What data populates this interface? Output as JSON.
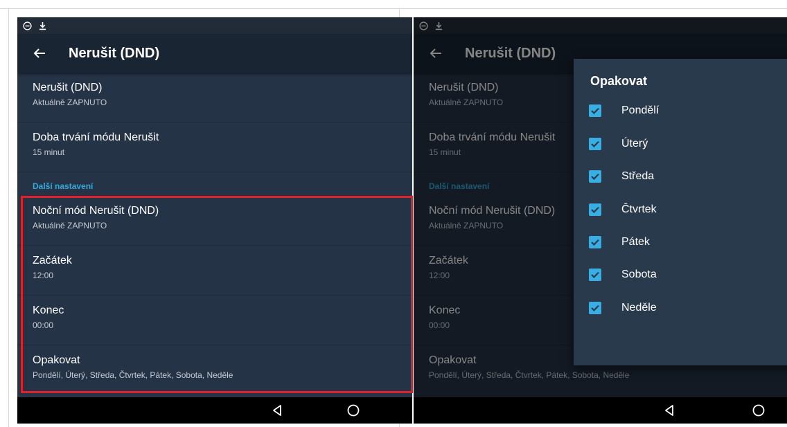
{
  "app": {
    "title": "Nerušit (DND)"
  },
  "settings": [
    {
      "title": "Nerušit (DND)",
      "sub": "Aktuálně ZAPNUTO"
    },
    {
      "title": "Doba trvání módu Nerušit",
      "sub": "15 minut"
    }
  ],
  "section": {
    "header": "Další nastavení"
  },
  "night": [
    {
      "title": "Noční mód Nerušit (DND)",
      "sub": "Aktuálně ZAPNUTO"
    },
    {
      "title": "Začátek",
      "sub": "12:00"
    },
    {
      "title": "Konec",
      "sub": "00:00"
    },
    {
      "title": "Opakovat",
      "sub": "Pondělí, Úterý, Středa, Čtvrtek, Pátek, Sobota, Neděle"
    }
  ],
  "dialog": {
    "title": "Opakovat",
    "options": [
      {
        "label": "Pondělí",
        "checked": true
      },
      {
        "label": "Úterý",
        "checked": true
      },
      {
        "label": "Středa",
        "checked": true
      },
      {
        "label": "Čtvrtek",
        "checked": true
      },
      {
        "label": "Pátek",
        "checked": true
      },
      {
        "label": "Sobota",
        "checked": true
      },
      {
        "label": "Neděle",
        "checked": true
      }
    ]
  },
  "icons": {
    "status_left": "do-not-disturb-icon",
    "status_right": "download-icon",
    "back": "arrow-back-icon",
    "nav_back": "nav-back-triangle-icon",
    "nav_home": "nav-home-circle-icon",
    "checkbox": "checkbox-checked-icon"
  },
  "colors": {
    "accent": "#37a9d8",
    "checkbox": "#38aee2",
    "highlight": "#e0202a",
    "background": "#253346",
    "appbar": "#1a2533"
  }
}
